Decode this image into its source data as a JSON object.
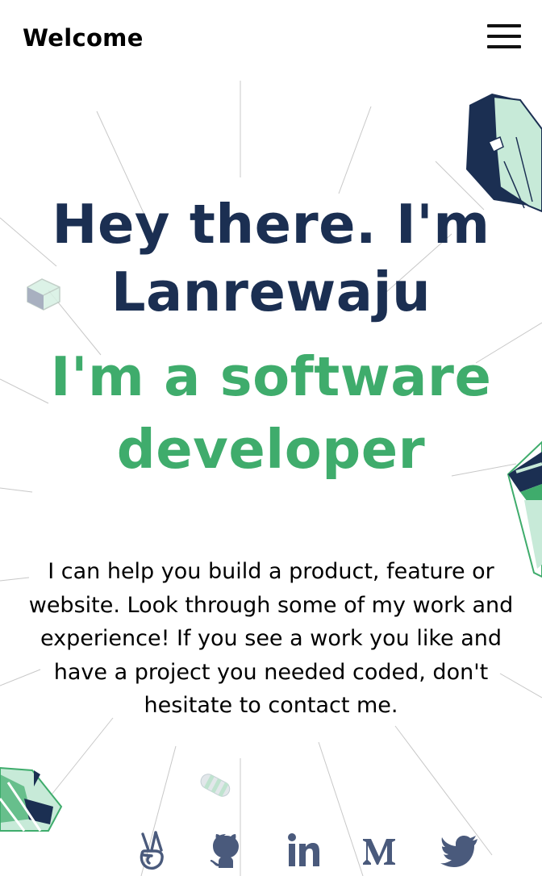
{
  "header": {
    "brand": "Welcome",
    "menu_icon": "hamburger-menu-icon"
  },
  "hero": {
    "headline": "Hey there. I'm Lanrewaju",
    "subheadline": "I'm a software developer",
    "intro": "I can help you build a product, feature or website. Look through some of my work and experience! If you see a work you like and have a project you needed coded, don't hesitate to contact me."
  },
  "socials": [
    {
      "icon": "angellist-icon"
    },
    {
      "icon": "github-icon"
    },
    {
      "icon": "linkedin-icon"
    },
    {
      "icon": "medium-icon"
    },
    {
      "icon": "twitter-icon"
    }
  ],
  "colors": {
    "headline": "#1b2f52",
    "accent": "#3fac6c",
    "social_icons": "#4a5a7c",
    "shape_dark": "#1b2f52",
    "shape_light": "#c7ead8"
  }
}
